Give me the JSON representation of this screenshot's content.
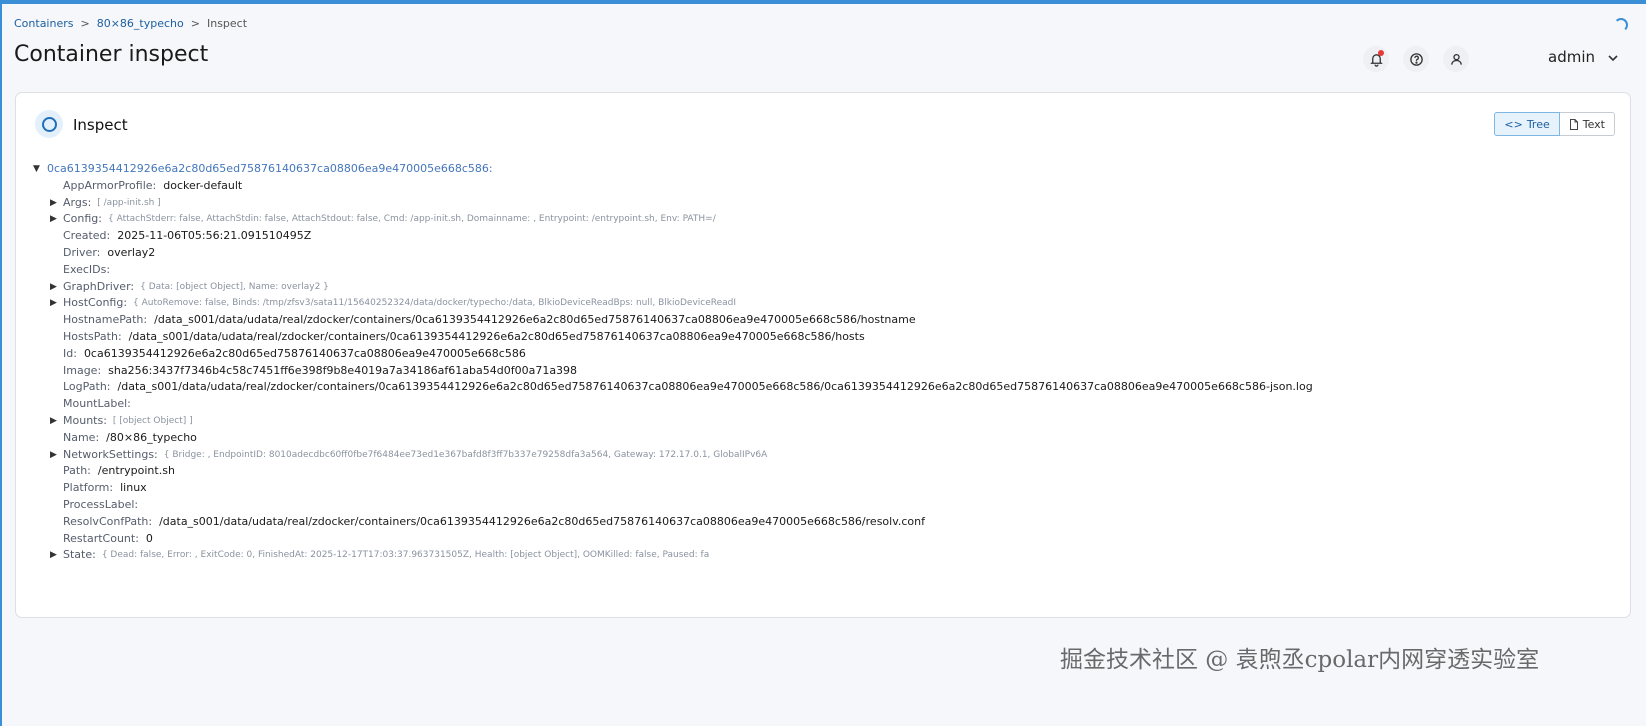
{
  "breadcrumb": {
    "items": [
      "Containers",
      "80×86_typecho",
      "Inspect"
    ],
    "separator": ">"
  },
  "page": {
    "title": "Container inspect"
  },
  "header": {
    "user": "admin",
    "icons": [
      "bell-icon",
      "help-icon",
      "user-icon",
      "chevron-down-icon",
      "loading-spinner"
    ]
  },
  "panel": {
    "title": "Inspect",
    "view_toggle": {
      "tree": "Tree",
      "text": "Text",
      "active": "Tree"
    }
  },
  "tree": {
    "root_key": "0ca6139354412926e6a2c80d65ed75876140637ca08806ea9e470005e668c586:",
    "rows": [
      {
        "key": "AppArmorProfile:",
        "value": "docker-default",
        "collapsed": false
      },
      {
        "key": "Args:",
        "preview": "[ /app-init.sh ]",
        "collapsed": true
      },
      {
        "key": "Config:",
        "preview": "{ AttachStderr: false, AttachStdin: false, AttachStdout: false, Cmd: /app-init.sh, Domainname: , Entrypoint: /entrypoint.sh, Env: PATH=/",
        "collapsed": true
      },
      {
        "key": "Created:",
        "value": "2025-11-06T05:56:21.091510495Z",
        "collapsed": false
      },
      {
        "key": "Driver:",
        "value": "overlay2",
        "collapsed": false
      },
      {
        "key": "ExecIDs:",
        "value": "",
        "collapsed": false
      },
      {
        "key": "GraphDriver:",
        "preview": "{ Data: [object Object], Name: overlay2 }",
        "collapsed": true
      },
      {
        "key": "HostConfig:",
        "preview": "{ AutoRemove: false, Binds: /tmp/zfsv3/sata11/15640252324/data/docker/typecho:/data, BlkioDeviceReadBps: null, BlkioDeviceReadI",
        "collapsed": true
      },
      {
        "key": "HostnamePath:",
        "value": "/data_s001/data/udata/real/zdocker/containers/0ca6139354412926e6a2c80d65ed75876140637ca08806ea9e470005e668c586/hostname",
        "collapsed": false
      },
      {
        "key": "HostsPath:",
        "value": "/data_s001/data/udata/real/zdocker/containers/0ca6139354412926e6a2c80d65ed75876140637ca08806ea9e470005e668c586/hosts",
        "collapsed": false
      },
      {
        "key": "Id:",
        "value": "0ca6139354412926e6a2c80d65ed75876140637ca08806ea9e470005e668c586",
        "collapsed": false
      },
      {
        "key": "Image:",
        "value": "sha256:3437f7346b4c58c7451ff6e398f9b8e4019a7a34186af61aba54d0f00a71a398",
        "collapsed": false
      },
      {
        "key": "LogPath:",
        "value": "/data_s001/data/udata/real/zdocker/containers/0ca6139354412926e6a2c80d65ed75876140637ca08806ea9e470005e668c586/0ca6139354412926e6a2c80d65ed75876140637ca08806ea9e470005e668c586-json.log",
        "collapsed": false
      },
      {
        "key": "MountLabel:",
        "value": "",
        "collapsed": false
      },
      {
        "key": "Mounts:",
        "preview": "[ [object Object] ]",
        "collapsed": true
      },
      {
        "key": "Name:",
        "value": "/80×86_typecho",
        "collapsed": false
      },
      {
        "key": "NetworkSettings:",
        "preview": "{ Bridge: , EndpointID: 8010adecdbc60ff0fbe7f6484ee73ed1e367bafd8f3ff7b337e79258dfa3a564, Gateway: 172.17.0.1, GlobalIPv6A",
        "collapsed": true
      },
      {
        "key": "Path:",
        "value": "/entrypoint.sh",
        "collapsed": false
      },
      {
        "key": "Platform:",
        "value": "linux",
        "collapsed": false
      },
      {
        "key": "ProcessLabel:",
        "value": "",
        "collapsed": false
      },
      {
        "key": "ResolvConfPath:",
        "value": "/data_s001/data/udata/real/zdocker/containers/0ca6139354412926e6a2c80d65ed75876140637ca08806ea9e470005e668c586/resolv.conf",
        "collapsed": false
      },
      {
        "key": "RestartCount:",
        "value": "0",
        "collapsed": false
      },
      {
        "key": "State:",
        "preview": "{ Dead: false, Error: , ExitCode: 0, FinishedAt: 2025-12-17T17:03:37.963731505Z, Health: [object Object], OOMKilled: false, Paused: fa",
        "collapsed": true
      }
    ]
  },
  "watermark": "掘金技术社区 @ 袁煦丞cpolar内网穿透实验室",
  "colors": {
    "accent": "#3a8fd6",
    "link": "#1e5fa0",
    "key": "#555d6b",
    "root_key": "#4477bb"
  }
}
